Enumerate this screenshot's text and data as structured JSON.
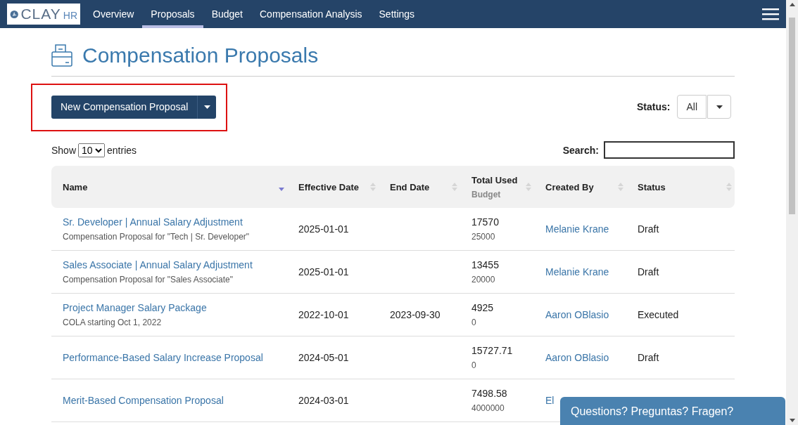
{
  "navbar": {
    "logo": {
      "main": "CLAY",
      "suffix": "HR"
    },
    "items": [
      {
        "label": "Overview",
        "selected": false
      },
      {
        "label": "Proposals",
        "selected": true
      },
      {
        "label": "Budget",
        "selected": false
      },
      {
        "label": "Compensation Analysis",
        "selected": false
      },
      {
        "label": "Settings",
        "selected": false
      }
    ]
  },
  "page_title": "Compensation Proposals",
  "new_button": {
    "label": "New Compensation Proposal",
    "highlighted": true
  },
  "status_filter": {
    "label": "Status:",
    "value": "All"
  },
  "length": {
    "prefix": "Show",
    "value": "10",
    "suffix": "entries"
  },
  "search": {
    "label": "Search:"
  },
  "table": {
    "columns": [
      {
        "label": "Name",
        "sorted": true
      },
      {
        "label": "Effective Date",
        "sorted": false
      },
      {
        "label": "End Date",
        "sorted": false
      },
      {
        "label": "Total Used",
        "sublabel": "Budget",
        "sorted": false
      },
      {
        "label": "Created By",
        "sorted": false
      },
      {
        "label": "Status",
        "sorted": false
      }
    ],
    "rows": [
      {
        "name": "Sr. Developer | Annual Salary Adjustment",
        "description": "Compensation Proposal for \"Tech | Sr. Developer\"",
        "effective_date": "2025-01-01",
        "total_used": "17570",
        "budget": "25000",
        "created_by": "Melanie Krane",
        "status": "Draft"
      },
      {
        "name": "Sales Associate | Annual Salary Adjustment",
        "description": "Compensation Proposal for \"Sales Associate\"",
        "effective_date": "2025-01-01",
        "total_used": "13455",
        "budget": "20000",
        "created_by": "Melanie Krane",
        "status": "Draft"
      },
      {
        "name": "Project Manager Salary Package",
        "description": "COLA starting Oct 1, 2022",
        "effective_date": "2022-10-01",
        "end_date": "2023-09-30",
        "total_used": "4925",
        "budget": "0",
        "created_by": "Aaron OBlasio",
        "status": "Executed"
      },
      {
        "name": "Performance-Based Salary Increase Proposal",
        "effective_date": "2024-05-01",
        "total_used": "15727.71",
        "budget": "0",
        "created_by": "Aaron OBlasio",
        "status": "Draft"
      },
      {
        "name": "Merit-Based Compensation Proposal",
        "effective_date": "2024-03-01",
        "total_used": "7498.58",
        "budget": "4000000",
        "created_by": "El"
      }
    ]
  },
  "chat_widget": {
    "label": "Questions? Preguntas? Fragen?"
  }
}
